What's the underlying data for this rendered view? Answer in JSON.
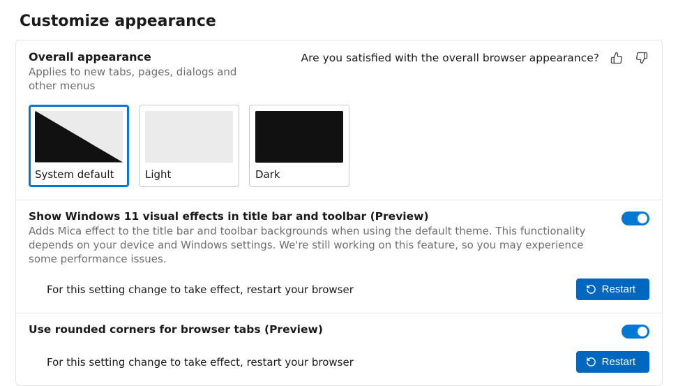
{
  "page": {
    "title": "Customize appearance"
  },
  "overall": {
    "heading": "Overall appearance",
    "subtext": "Applies to new tabs, pages, dialogs and other menus",
    "feedback_prompt": "Are you satisfied with the overall browser appearance?",
    "themes": {
      "system": "System default",
      "light": "Light",
      "dark": "Dark"
    },
    "selected": "system"
  },
  "mica": {
    "title": "Show Windows 11 visual effects in title bar and toolbar (Preview)",
    "desc": "Adds Mica effect to the title bar and toolbar backgrounds when using the default theme. This functionality depends on your device and Windows settings. We're still working on this feature, so you may experience some performance issues.",
    "enabled": true,
    "restart_text": "For this setting change to take effect, restart your browser",
    "restart_label": "Restart"
  },
  "rounded": {
    "title": "Use rounded corners for browser tabs (Preview)",
    "enabled": true,
    "restart_text": "For this setting change to take effect, restart your browser",
    "restart_label": "Restart"
  }
}
